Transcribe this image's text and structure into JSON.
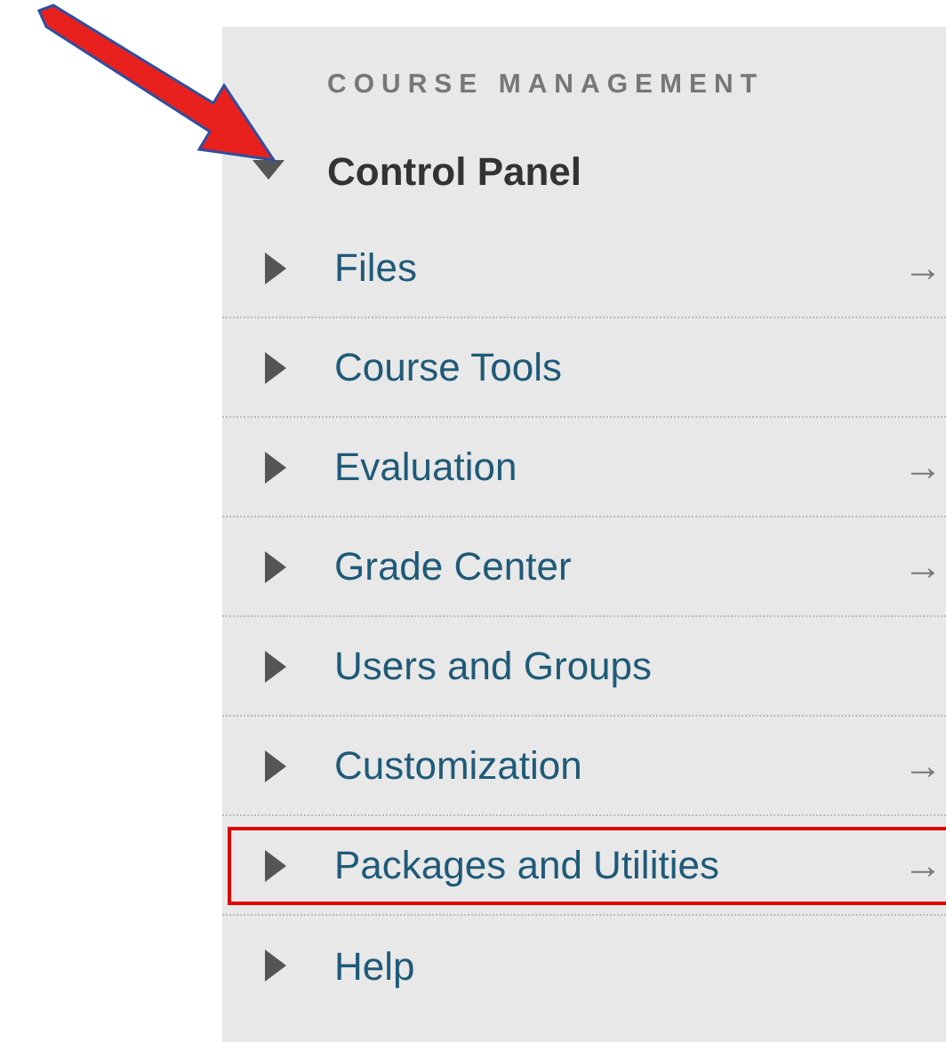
{
  "section_title": "COURSE MANAGEMENT",
  "control_panel": {
    "label": "Control Panel",
    "expanded": true
  },
  "items": [
    {
      "label": "Files",
      "arrow": "→",
      "highlighted": false
    },
    {
      "label": "Course Tools",
      "highlighted": false
    },
    {
      "label": "Evaluation",
      "arrow": "→",
      "highlighted": false
    },
    {
      "label": "Grade Center",
      "arrow": "→",
      "highlighted": false
    },
    {
      "label": "Users and Groups",
      "highlighted": false
    },
    {
      "label": "Customization",
      "arrow": "→",
      "highlighted": false
    },
    {
      "label": "Packages and Utilities",
      "arrow": "→",
      "highlighted": true
    },
    {
      "label": "Help",
      "highlighted": false
    }
  ]
}
